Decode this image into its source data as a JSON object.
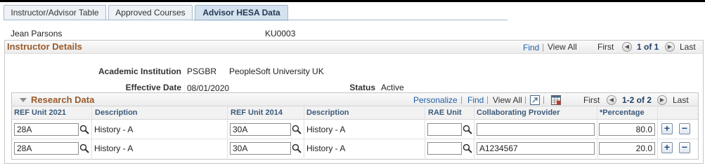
{
  "tabs": [
    {
      "label": "Instructor/Advisor Table",
      "active": false
    },
    {
      "label": "Approved Courses",
      "active": false
    },
    {
      "label": "Advisor HESA Data",
      "active": true
    }
  ],
  "person": {
    "name": "Jean Parsons",
    "id": "KU0003"
  },
  "instructor_details": {
    "title": "Instructor Details",
    "find": "Find",
    "sep": "|",
    "view_all": "View All",
    "first": "First",
    "page": "1 of 1",
    "last": "Last",
    "institution_label": "Academic Institution",
    "institution_code": "PSGBR",
    "institution_name": "PeopleSoft University UK",
    "effdt_label": "Effective Date",
    "effdt": "08/01/2020",
    "status_label": "Status",
    "status": "Active"
  },
  "research": {
    "title": "Research Data",
    "personalize": "Personalize",
    "find": "Find",
    "view_all": "View All",
    "first": "First",
    "page": "1-2 of 2",
    "last": "Last",
    "columns": {
      "ref2021": "REF Unit 2021",
      "desc1": "Description",
      "ref2014": "REF Unit 2014",
      "desc2": "Description",
      "rae": "RAE Unit",
      "collab": "Collaborating Provider",
      "pct": "*Percentage"
    },
    "rows": [
      {
        "ref2021": "28A",
        "desc1": "History - A",
        "ref2014": "30A",
        "desc2": "History - A",
        "rae": "",
        "collab": "",
        "pct": "80.0"
      },
      {
        "ref2021": "28A",
        "desc1": "History - A",
        "ref2014": "30A",
        "desc2": "History - A",
        "rae": "",
        "collab": "A1234567",
        "pct": "20.0"
      }
    ]
  },
  "icons": {
    "lookup": "magnifier-icon",
    "add": "plus-icon",
    "delete": "minus-icon",
    "prev": "arrow-left-icon",
    "next": "arrow-right-icon",
    "zoom": "zoom-grid-icon",
    "download": "download-grid-icon"
  }
}
